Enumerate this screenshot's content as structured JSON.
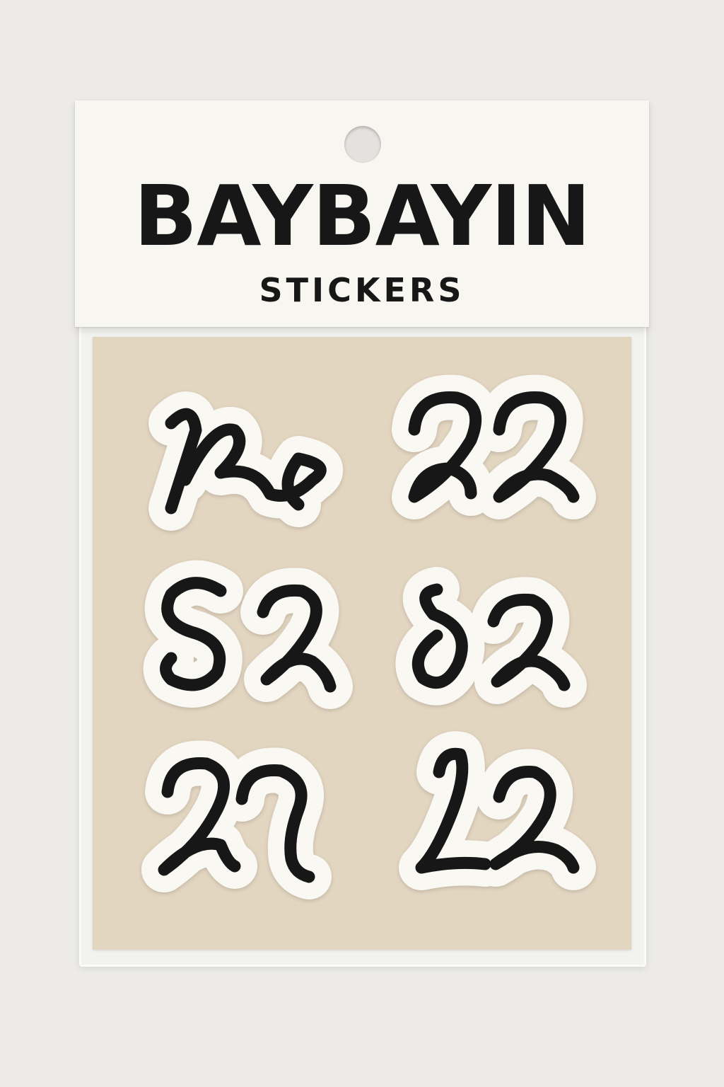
{
  "package": {
    "title": "BAYBAYIN",
    "subtitle": "STICKERS"
  },
  "colors": {
    "background": "#ecebe8",
    "header_card": "#f8f6f1",
    "sticker_sheet": "#e3d6c1",
    "sticker_fill": "#faf8f3",
    "ink": "#171717"
  },
  "stickers": [
    {
      "icon": "baybayin-glyph-ka-icon"
    },
    {
      "icon": "baybayin-glyph-double-a-icon"
    },
    {
      "icon": "baybayin-glyph-sa-icon"
    },
    {
      "icon": "baybayin-glyph-da-icon"
    },
    {
      "icon": "baybayin-glyph-wa-icon"
    },
    {
      "icon": "baybayin-glyph-la-icon"
    }
  ]
}
